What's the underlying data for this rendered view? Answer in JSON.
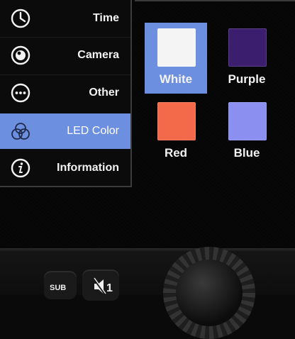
{
  "menu": {
    "items": [
      {
        "label": "Time",
        "icon": "clock-icon",
        "selected": false
      },
      {
        "label": "Camera",
        "icon": "camera-lens-icon",
        "selected": false
      },
      {
        "label": "Other",
        "icon": "more-dots-icon",
        "selected": false
      },
      {
        "label": "LED Color",
        "icon": "color-circles-icon",
        "selected": true
      },
      {
        "label": "Information",
        "icon": "info-icon",
        "selected": false
      }
    ]
  },
  "led_colors": {
    "options": [
      {
        "label": "White",
        "color": "#f4f4f4",
        "selected": true
      },
      {
        "label": "Purple",
        "color": "#3b1f6e",
        "selected": false
      },
      {
        "label": "Red",
        "color": "#f26a4a",
        "selected": false
      },
      {
        "label": "Blue",
        "color": "#8a8ff0",
        "selected": false
      }
    ]
  },
  "hardware": {
    "sub_button_label": "SUB",
    "mute_button_label": "1"
  },
  "colors": {
    "accent": "#6d8fe0",
    "menu_background": "#0b0b0b",
    "text": "#f2f2f2"
  }
}
